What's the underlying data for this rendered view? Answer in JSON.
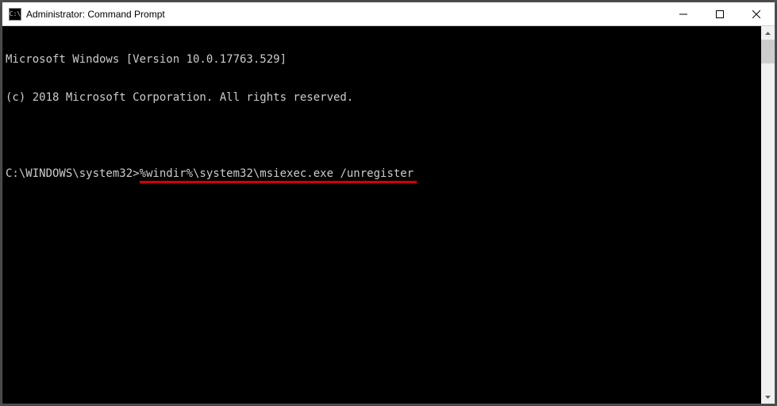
{
  "titlebar": {
    "icon_text": "C:\\",
    "title": "Administrator: Command Prompt"
  },
  "window_controls": {
    "minimize": "minimize",
    "maximize": "maximize",
    "close": "close"
  },
  "terminal": {
    "line1": "Microsoft Windows [Version 10.0.17763.529]",
    "line2": "(c) 2018 Microsoft Corporation. All rights reserved.",
    "prompt": "C:\\WINDOWS\\system32>",
    "command": "%windir%\\system32\\msiexec.exe /unregister"
  },
  "annotation": {
    "underline_color": "#d40000"
  }
}
